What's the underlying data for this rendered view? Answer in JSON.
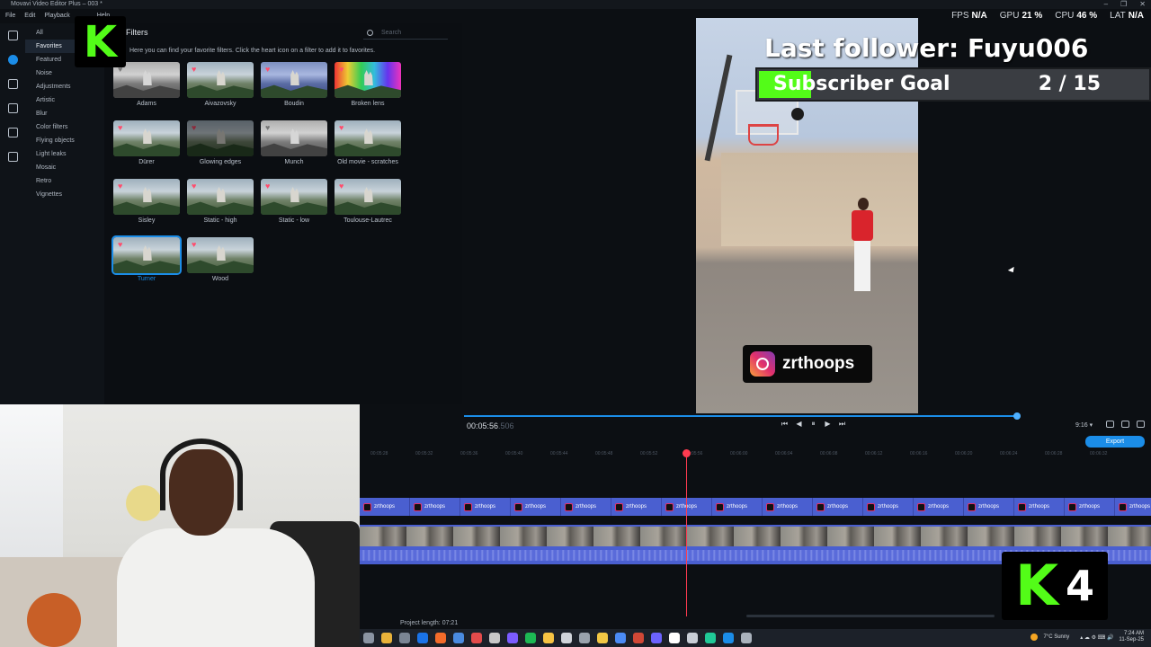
{
  "window": {
    "title": "Movavi Video Editor Plus – 003 *",
    "controls": [
      "–",
      "❐",
      "✕"
    ]
  },
  "menu": [
    "File",
    "Edit",
    "Playback",
    "Help"
  ],
  "stats": [
    {
      "key": "FPS",
      "value": "N/A"
    },
    {
      "key": "GPU",
      "value": "21 %"
    },
    {
      "key": "CPU",
      "value": "46 %"
    },
    {
      "key": "LAT",
      "value": "N/A"
    }
  ],
  "rail": [
    "import-icon",
    "filters-icon",
    "transitions-icon",
    "titles-icon",
    "stickers-icon",
    "more-tools-icon"
  ],
  "categories": [
    "All",
    "Favorites",
    "Featured",
    "Noise",
    "Adjustments",
    "Artistic",
    "Blur",
    "Color filters",
    "Flying objects",
    "Light leaks",
    "Mosaic",
    "Retro",
    "Vignettes"
  ],
  "selected_category": "Favorites",
  "filters_panel": {
    "title": "Filters",
    "search_placeholder": "Search",
    "help": "Here you can find your favorite filters. Click the heart icon on a filter to add it to favorites."
  },
  "filters": [
    {
      "name": "Adams",
      "style": "gray"
    },
    {
      "name": "Aivazovsky",
      "style": "normal"
    },
    {
      "name": "Boudin",
      "style": "blue"
    },
    {
      "name": "Broken lens",
      "style": "rainbow"
    },
    {
      "name": "Dürer",
      "style": "normal"
    },
    {
      "name": "Glowing edges",
      "style": "dark"
    },
    {
      "name": "Munch",
      "style": "gray"
    },
    {
      "name": "Old movie - scratches",
      "style": "normal"
    },
    {
      "name": "Sisley",
      "style": "normal"
    },
    {
      "name": "Static - high",
      "style": "normal"
    },
    {
      "name": "Static - low",
      "style": "normal"
    },
    {
      "name": "Toulouse-Lautrec",
      "style": "normal"
    },
    {
      "name": "Turner",
      "style": "normal",
      "selected": true
    },
    {
      "name": "Wood",
      "style": "normal"
    }
  ],
  "overlay": {
    "last_follower": "Last follower: Fuyu006",
    "goal_label": "Subscriber Goal",
    "goal_count": "2 / 15",
    "goal_progress": 0.1333,
    "kick_letter": "K",
    "kick_count": "4",
    "instagram_handle": "zrthoops"
  },
  "player": {
    "timecode": "00:05:56",
    "timecode_ms": ".506",
    "aspect": "9:16",
    "export_label": "Export",
    "position": 0.99
  },
  "timeline": {
    "ruler": [
      "00:05:28",
      "00:05:32",
      "00:05:36",
      "00:05:40",
      "00:05:44",
      "00:05:48",
      "00:05:52",
      "00:05:56",
      "00:06:00",
      "00:06:04",
      "00:06:08",
      "00:06:12",
      "00:06:16",
      "00:06:20",
      "00:06:24",
      "00:06:28",
      "00:06:32"
    ],
    "overlay_clip_label": "zrthoops",
    "project_length": "Project length: 07:21"
  },
  "tray": {
    "weather": "7°C  Sunny",
    "time": "7:24 AM",
    "date": "11-Sep-25"
  },
  "colors": {
    "accent": "#1b8de8",
    "kick_green": "#53fc18",
    "playhead": "#ff3b50",
    "track": "#4a5fd0"
  }
}
